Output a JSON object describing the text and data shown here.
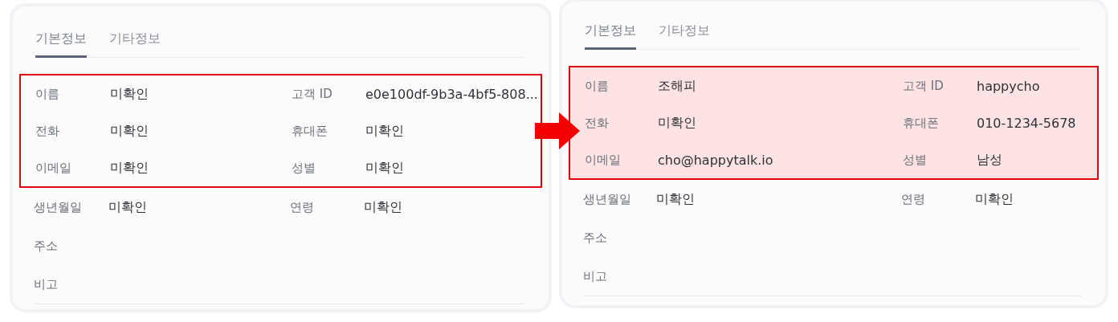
{
  "panels": [
    {
      "tabs": [
        {
          "label": "기본정보",
          "selected": true
        },
        {
          "label": "기타정보",
          "selected": false
        }
      ],
      "highlight_filled": false,
      "rows": [
        {
          "highlighted": true,
          "fields": [
            {
              "label": "이름",
              "value": "미확인"
            },
            {
              "label": "고객 ID",
              "value": "e0e100df-9b3a-4bf5-808..."
            }
          ]
        },
        {
          "highlighted": true,
          "fields": [
            {
              "label": "전화",
              "value": "미확인"
            },
            {
              "label": "휴대폰",
              "value": "미확인"
            }
          ]
        },
        {
          "highlighted": true,
          "fields": [
            {
              "label": "이메일",
              "value": "미확인"
            },
            {
              "label": "성별",
              "value": "미확인"
            }
          ]
        },
        {
          "highlighted": false,
          "fields": [
            {
              "label": "생년월일",
              "value": "미확인"
            },
            {
              "label": "연령",
              "value": "미확인"
            }
          ]
        },
        {
          "highlighted": false,
          "fields": [
            {
              "label": "주소"
            }
          ]
        },
        {
          "highlighted": false,
          "fields": [
            {
              "label": "비고"
            }
          ]
        }
      ]
    },
    {
      "tabs": [
        {
          "label": "기본정보",
          "selected": true
        },
        {
          "label": "기타정보",
          "selected": false
        }
      ],
      "highlight_filled": true,
      "rows": [
        {
          "highlighted": true,
          "fields": [
            {
              "label": "이름",
              "value": "조해피"
            },
            {
              "label": "고객 ID",
              "value": "happycho"
            }
          ]
        },
        {
          "highlighted": true,
          "fields": [
            {
              "label": "전화",
              "value": "미확인"
            },
            {
              "label": "휴대폰",
              "value": "010-1234-5678"
            }
          ]
        },
        {
          "highlighted": true,
          "fields": [
            {
              "label": "이메일",
              "value": "cho@happytalk.io"
            },
            {
              "label": "성별",
              "value": "남성"
            }
          ]
        },
        {
          "highlighted": false,
          "fields": [
            {
              "label": "생년월일",
              "value": "미확인"
            },
            {
              "label": "연령",
              "value": "미확인"
            }
          ]
        },
        {
          "highlighted": false,
          "fields": [
            {
              "label": "주소"
            }
          ]
        },
        {
          "highlighted": false,
          "fields": [
            {
              "label": "비고"
            }
          ]
        }
      ]
    }
  ]
}
